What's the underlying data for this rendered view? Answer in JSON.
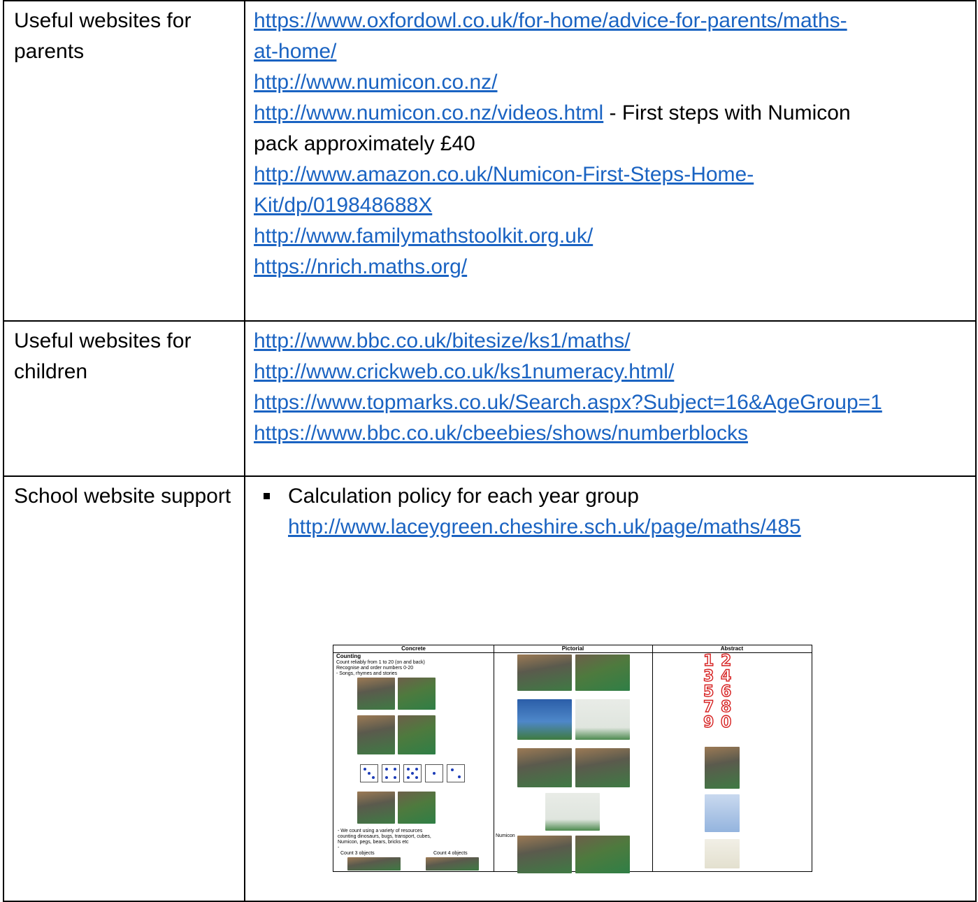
{
  "rows": [
    {
      "label": "Useful websites for parents",
      "links": [
        {
          "lines": [
            "https://www.oxfordowl.co.uk/for-home/advice-for-parents/maths-",
            "at-home/"
          ]
        },
        {
          "lines": [
            "http://www.numicon.co.nz/"
          ]
        },
        {
          "lines": [
            "http://www.numicon.co.nz/videos.html"
          ],
          "suffix": " - First steps with Numicon",
          "after": "pack approximately £40"
        },
        {
          "lines": [
            "http://www.amazon.co.uk/Numicon-First-Steps-Home-",
            "Kit/dp/019848688X"
          ]
        },
        {
          "lines": [
            "http://www.familymathstoolkit.org.uk/"
          ]
        },
        {
          "lines": [
            "https://nrich.maths.org/"
          ]
        }
      ]
    },
    {
      "label": "Useful websites for children",
      "links": [
        {
          "lines": [
            "http://www.bbc.co.uk/bitesize/ks1/maths/"
          ]
        },
        {
          "lines": [
            "http://www.crickweb.co.uk/ks1numeracy.html/"
          ]
        },
        {
          "lines": [
            "https://www.topmarks.co.uk/Search.aspx?Subject=16&AgeGroup=1"
          ]
        },
        {
          "lines": [
            "https://www.bbc.co.uk/cbeebies/shows/numberblocks"
          ]
        }
      ]
    },
    {
      "label": "School website support",
      "bullet_text": "Calculation policy for each year group",
      "bullet_link": "http://www.laceygreen.cheshire.sch.uk/page/maths/485"
    }
  ],
  "thumbnail": {
    "headers": [
      "Concrete",
      "Pictorial",
      "Abstract"
    ],
    "counting_title": "Counting",
    "counting_lines": [
      "Count reliably from 1 to 20 (on and back)",
      "Recognise and order numbers 0-20",
      "-        Songs, rhymes and stories"
    ],
    "resources_lines": [
      "-     We count using a variety of resources",
      "      counting dinosaurs, bugs, transport, cubes,",
      "      Numicon, pegs, bears, bricks etc",
      "-"
    ],
    "count3": "Count 3 objects",
    "count4": "Count 4 objects",
    "numicon_label": "Numicon",
    "digits": [
      "1",
      "2",
      "3",
      "4",
      "5",
      "6",
      "7",
      "8",
      "9",
      "0"
    ]
  }
}
